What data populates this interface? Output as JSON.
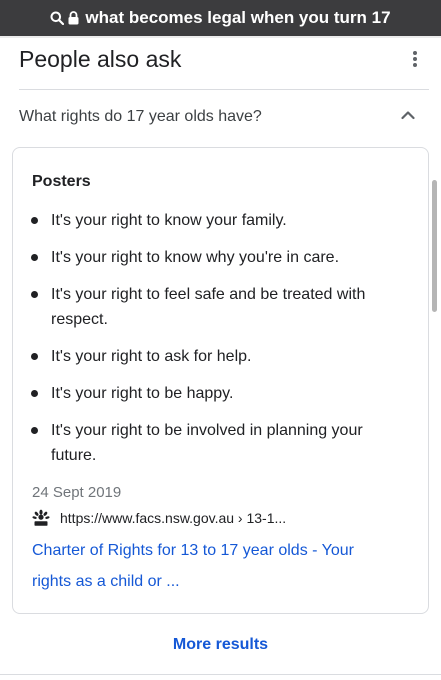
{
  "browser": {
    "search_query": "what becomes legal when you turn 17"
  },
  "paa": {
    "title": "People also ask",
    "question": "What rights do 17 year olds have?",
    "answer": {
      "heading": "Posters",
      "bullets": [
        "It's your right to know your family.",
        "It's your right to know why you're in care.",
        "It's your right to feel safe and be treated with respect.",
        "It's your right to ask for help.",
        "It's your right to be happy.",
        "It's your right to be involved in planning your future."
      ],
      "date": "24 Sept 2019",
      "source_url": "https://www.facs.nsw.gov.au › 13-1...",
      "link_text": "Charter of Rights for 13 to 17 year olds - Your rights as a child or ..."
    },
    "more_results": "More results"
  },
  "colors": {
    "url_bar": "#3c3c3e",
    "link": "#1558d6",
    "text": "#202124",
    "muted": "#70757a"
  },
  "icons": {
    "search": "search-icon",
    "lock": "lock-icon",
    "menu": "more-vert-icon",
    "collapse": "chevron-up-icon",
    "favicon": "nsw-waratah-icon"
  }
}
